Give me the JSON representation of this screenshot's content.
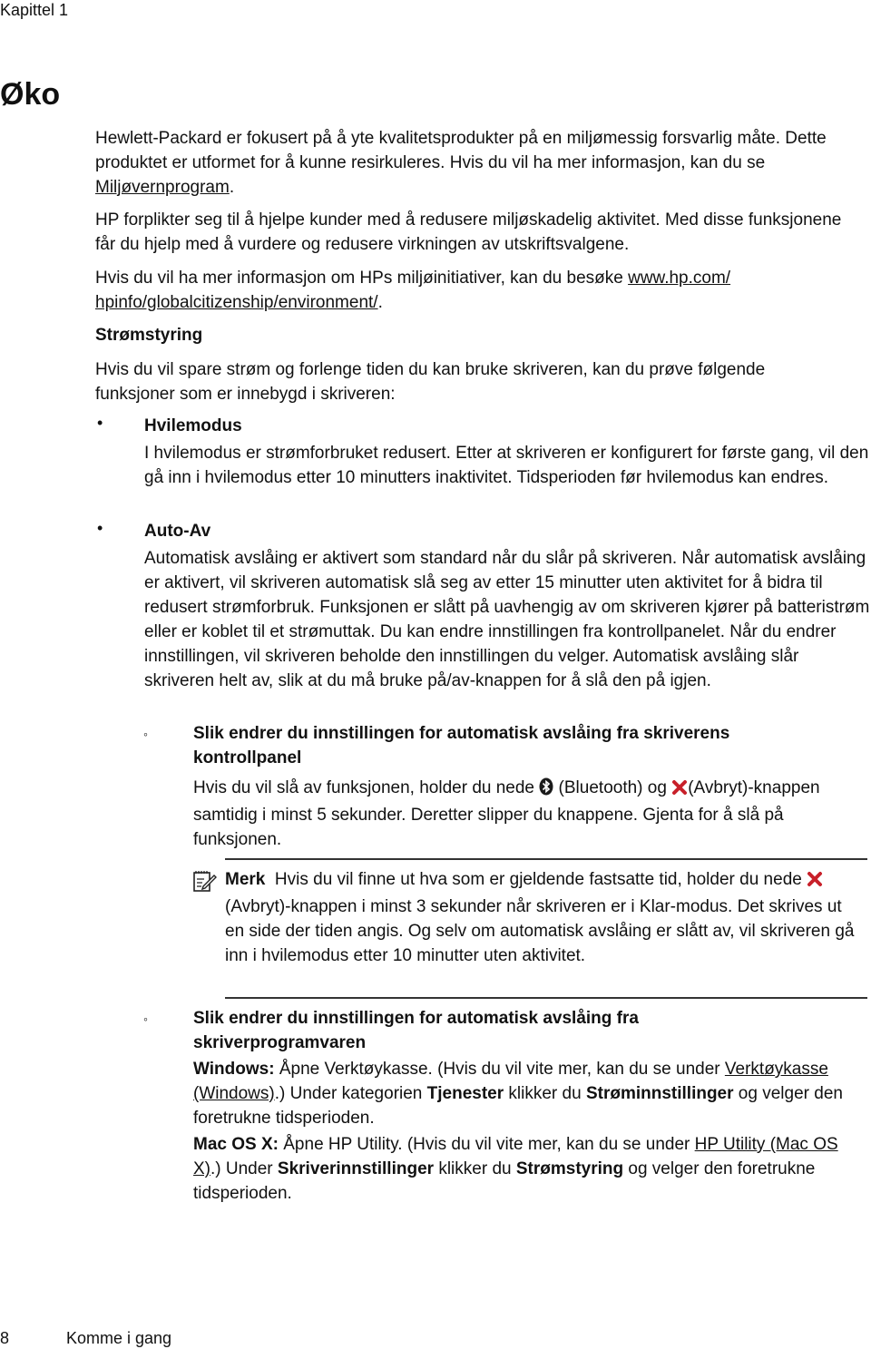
{
  "header": {
    "chapter": "Kapittel 1"
  },
  "page_title": "Øko",
  "intro": {
    "p1_text": "Hewlett-Packard er fokusert på å yte kvalitetsprodukter på en miljømessig forsvarlig måte. Dette produktet er utformet for å kunne resirkuleres. Hvis du vil ha mer informasjon, kan du se ",
    "p1_link": "Miljøvernprogram",
    "p1_end": ".",
    "p2_text": "HP forplikter seg til å hjelpe kunder med å redusere miljøskadelig aktivitet. Med disse funksjonene får du hjelp med å vurdere og redusere virkningen av utskriftsvalgene.",
    "p3_text": "Hvis du vil ha mer informasjon om HPs miljøinitiativer, kan du besøke ",
    "p3_link": "www.hp.com/ hpinfo/globalcitizenship/environment/",
    "p3_end": "."
  },
  "power": {
    "heading": "Strømstyring",
    "intro": "Hvis du vil spare strøm og forlenge tiden du kan bruke skriveren, kan du prøve følgende funksjoner som er innebygd i skriveren:",
    "bullet_char": "•",
    "items": [
      {
        "title": "Hvilemodus",
        "text": "I hvilemodus er strømforbruket redusert. Etter at skriveren er konfigurert for første gang, vil den gå inn i hvilemodus etter 10 minutters inaktivitet. Tidsperioden før hvilemodus kan endres."
      },
      {
        "title": "Auto-Av",
        "text": "Automatisk avslåing er aktivert som standard når du slår på skriveren. Når automatisk avslåing er aktivert, vil skriveren automatisk slå seg av etter 15 minutter uten aktivitet for å bidra til redusert strømforbruk. Funksjonen er slått på uavhengig av om skriveren kjører på batteristrøm eller er koblet til et strømuttak. Du kan endre innstillingen fra kontrollpanelet. Når du endrer innstillingen, vil skriveren beholde den innstillingen du velger. Automatisk avslåing slår skriveren helt av, slik at du må bruke på/av-knappen for å slå den på igjen."
      }
    ],
    "sub_bullet_char": "◦",
    "sub1": {
      "title": "Slik endrer du innstillingen for automatisk avslåing fra skriverens kontrollpanel",
      "text_a": "Hvis du vil slå av funksjonen, holder du nede ",
      "text_b": " (Bluetooth) og ",
      "text_c": "(Avbryt)-knappen samtidig i minst 5 sekunder. Deretter slipper du knappene. Gjenta for å slå på funksjonen."
    },
    "note": {
      "label": "Merk",
      "text_a": "Hvis du vil finne ut hva som er gjeldende fastsatte tid, holder du nede ",
      "text_b": "(Avbryt)-knappen i minst 3 sekunder når skriveren er i Klar-modus. Det skrives ut en side der tiden angis. Og selv om automatisk avslåing er slått av, vil skriveren gå inn i hvilemodus etter 10 minutter uten aktivitet."
    },
    "sub2": {
      "title": "Slik endrer du innstillingen for automatisk avslåing fra skriverprogramvaren",
      "win_label": "Windows:",
      "win_text_a": " Åpne Verktøykasse. (Hvis du vil vite mer, kan du se under ",
      "win_link": "Verktøykasse (Windows)",
      "win_text_b": ".) Under kategorien ",
      "win_bold1": "Tjenester",
      "win_text_c": " klikker du ",
      "win_bold2": "Strøminnstillinger",
      "win_text_d": " og velger den foretrukne tidsperioden.",
      "mac_label": "Mac OS X:",
      "mac_text_a": " Åpne HP Utility. (Hvis du vil vite mer, kan du se under ",
      "mac_link": "HP Utility (Mac OS X)",
      "mac_text_b": ".) Under ",
      "mac_bold1": "Skriverinnstillinger",
      "mac_text_c": " klikker du ",
      "mac_bold2": "Strømstyring",
      "mac_text_d": " og velger den foretrukne tidsperioden."
    }
  },
  "icons": {
    "bluetooth": "bluetooth-icon",
    "cancel": "cancel-x-icon",
    "note": "note-pencil-icon",
    "cancel_color": "#c8202a"
  },
  "footer": {
    "page_number": "8",
    "section": "Komme i gang"
  }
}
